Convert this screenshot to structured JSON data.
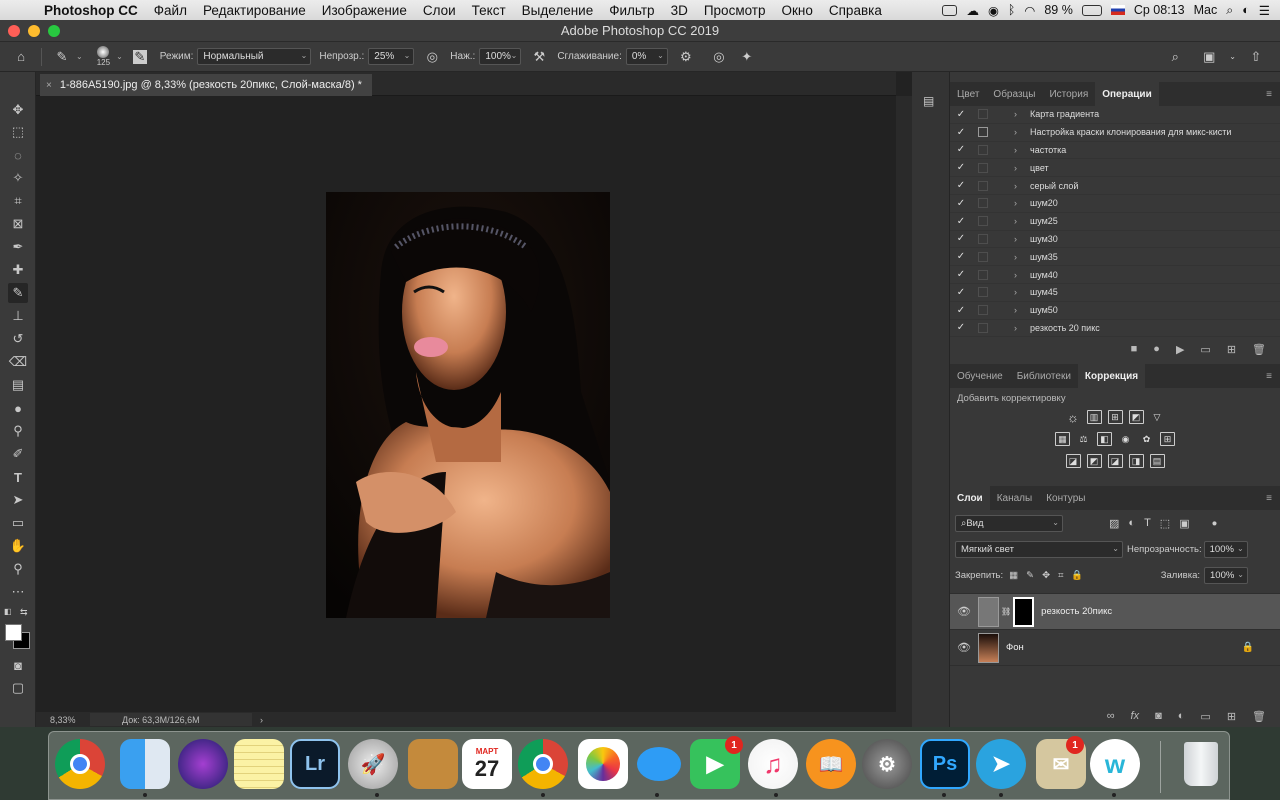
{
  "menubar": {
    "app": "Photoshop CC",
    "items": [
      "Файл",
      "Редактирование",
      "Изображение",
      "Слои",
      "Текст",
      "Выделение",
      "Фильтр",
      "3D",
      "Просмотр",
      "Окно",
      "Справка"
    ],
    "battery": "89 %",
    "clock": "Ср 08:13",
    "user": "Mac"
  },
  "window": {
    "title": "Adobe Photoshop CC 2019"
  },
  "options": {
    "brush_size": "125",
    "mode_label": "Режим:",
    "mode_value": "Нормальный",
    "opacity_label": "Непрозр.:",
    "opacity_value": "25%",
    "pressure_label": "Наж.:",
    "pressure_value": "100%",
    "smoothing_label": "Сглаживание:",
    "smoothing_value": "0%"
  },
  "document": {
    "tab_title": "1-886A5190.jpg @ 8,33% (резкость 20пикс, Слой-маска/8) *",
    "zoom": "8,33%",
    "doc_info": "Док: 63,3M/126,6M"
  },
  "panels": {
    "top_tabs": [
      "Цвет",
      "Образцы",
      "История",
      "Операции"
    ],
    "actions": [
      "Карта градиента",
      "Настройка краски клонирования для микс-кисти",
      "частотка",
      "цвет",
      "серый слой",
      "шум20",
      "шум25",
      "шум30",
      "шум35",
      "шум40",
      "шум45",
      "шум50",
      "резкость 20 пикс"
    ],
    "mid_tabs": [
      "Обучение",
      "Библиотеки",
      "Коррекция"
    ],
    "add_adjustment": "Добавить корректировку",
    "layer_tabs": [
      "Слои",
      "Каналы",
      "Контуры"
    ],
    "filter_value": "Вид",
    "blend_mode": "Мягкий свет",
    "opacity_label": "Непрозрачность:",
    "opacity_value": "100%",
    "lock_label": "Закрепить:",
    "fill_label": "Заливка:",
    "fill_value": "100%",
    "layers": [
      {
        "name": "резкость 20пикс"
      },
      {
        "name": "Фон"
      }
    ]
  },
  "dock": {
    "apps": [
      "chrome-icon",
      "finder-icon",
      "siri-icon",
      "notes-icon",
      "lightroom-icon",
      "launchpad-icon",
      "contacts-icon",
      "calendar-icon",
      "chrome-icon",
      "photos-icon",
      "messages-icon",
      "facetime-icon",
      "itunes-icon",
      "books-icon",
      "system-preferences-icon",
      "photoshop-icon",
      "telegram-icon",
      "mail-icon",
      "app-w-icon",
      "trash-icon"
    ],
    "lr_label": "Lr",
    "ps_label": "Ps",
    "calendar_month": "МАРТ",
    "calendar_day": "27",
    "badge_facetime": "1",
    "badge_mail": "1"
  },
  "colors": {
    "accent": "#e0261f",
    "panel_bg": "#383838",
    "canvas_bg": "#222222"
  }
}
